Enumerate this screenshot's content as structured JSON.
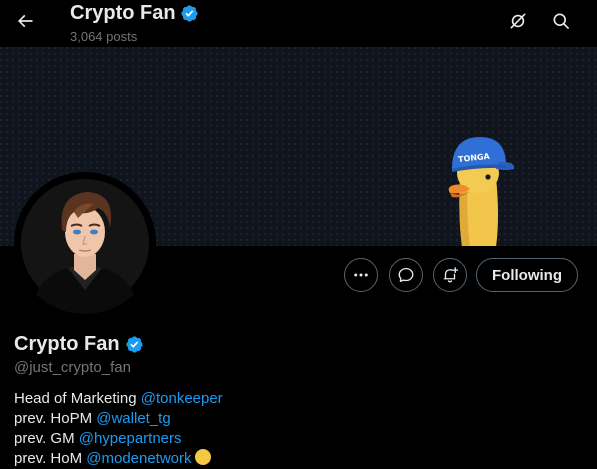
{
  "header": {
    "title": "Crypto Fan",
    "post_count": "3,064 posts"
  },
  "banner": {
    "cap_text": "TONGA"
  },
  "profile": {
    "name": "Crypto Fan",
    "handle": "@just_crypto_fan"
  },
  "actions": {
    "following_label": "Following"
  },
  "bio": [
    {
      "prefix": "Head of Marketing ",
      "mention": "@tonkeeper"
    },
    {
      "prefix": "prev. HoPM ",
      "mention": "@wallet_tg"
    },
    {
      "prefix": "prev. GM ",
      "mention": "@hypepartners"
    },
    {
      "prefix": "prev. HoM ",
      "mention": "@modenetwork"
    }
  ],
  "colors": {
    "accent": "#1d9bf0",
    "verified": "#1d9bf0",
    "text": "#e7e9ea",
    "muted": "#71767b",
    "background": "#000000"
  },
  "icons": {
    "back": "arrow-left-icon",
    "grok": "slashed-circle-icon",
    "search": "search-icon",
    "more": "more-dots-icon",
    "message": "message-bubble-icon",
    "notify": "bell-plus-icon",
    "verified": "verified-badge-icon",
    "bio_emoji": "yellow-circle-emoji"
  }
}
